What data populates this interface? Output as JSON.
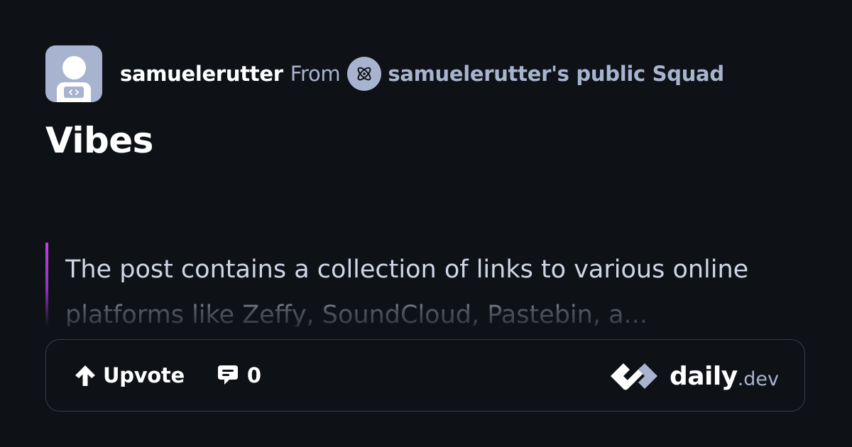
{
  "post": {
    "author": "samuelerutter",
    "from_label": "From",
    "squad_name": "samuelerutter's public Squad",
    "title": "Vibes",
    "summary": "The post contains a collection of links to various online platforms like Zeffy, SoundCloud, Pastebin, a..."
  },
  "actions": {
    "upvote_label": "Upvote",
    "comment_count": "0"
  },
  "brand": {
    "name": "daily",
    "suffix": ".dev"
  },
  "icons": {
    "avatar": "user-avatar-icon",
    "squad": "squad-atom-icon",
    "upvote": "arrow-up-icon",
    "comment": "comment-bubble-icon",
    "logo": "daily-dev-logo-icon"
  },
  "colors": {
    "background": "#0e1217",
    "text_primary": "#ffffff",
    "text_secondary": "#a8b3cf",
    "accent": "#c43ee4",
    "border": "#383d47"
  }
}
